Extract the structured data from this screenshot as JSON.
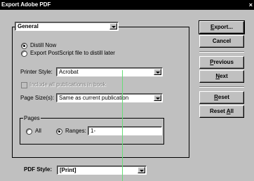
{
  "window": {
    "title": "Export Adobe PDF",
    "close_glyph": "×"
  },
  "preset": {
    "value": "General"
  },
  "distill": {
    "options": [
      "Distill Now",
      "Export PostScript file to distill later"
    ],
    "selected": 0
  },
  "printer_style": {
    "label": "Printer Style:",
    "value": "Acrobat"
  },
  "include_all": {
    "label": "Include all publications in book",
    "checked": false,
    "enabled": false
  },
  "page_size": {
    "label": "Page Size(s):",
    "value": "Same as current publication"
  },
  "pages": {
    "legend": "Pages",
    "all_label": "All",
    "ranges_label": "Ranges:",
    "ranges_value": "1-",
    "selected": "ranges"
  },
  "pdf_style": {
    "label": "PDF Style:",
    "value": "[Print]"
  },
  "buttons": {
    "export": {
      "pre": "",
      "u": "E",
      "post": "xport..."
    },
    "cancel": {
      "pre": "",
      "u": "",
      "post": "Cancel"
    },
    "previous": {
      "pre": "",
      "u": "P",
      "post": "revious"
    },
    "next": {
      "pre": "",
      "u": "N",
      "post": "ext"
    },
    "reset": {
      "pre": "",
      "u": "R",
      "post": "eset"
    },
    "reset_all": {
      "pre": "Reset ",
      "u": "A",
      "post": "ll"
    }
  },
  "colors": {
    "face": "#c0c0c0",
    "titlebar": "#000000",
    "cursor_line": "#66dd77"
  }
}
